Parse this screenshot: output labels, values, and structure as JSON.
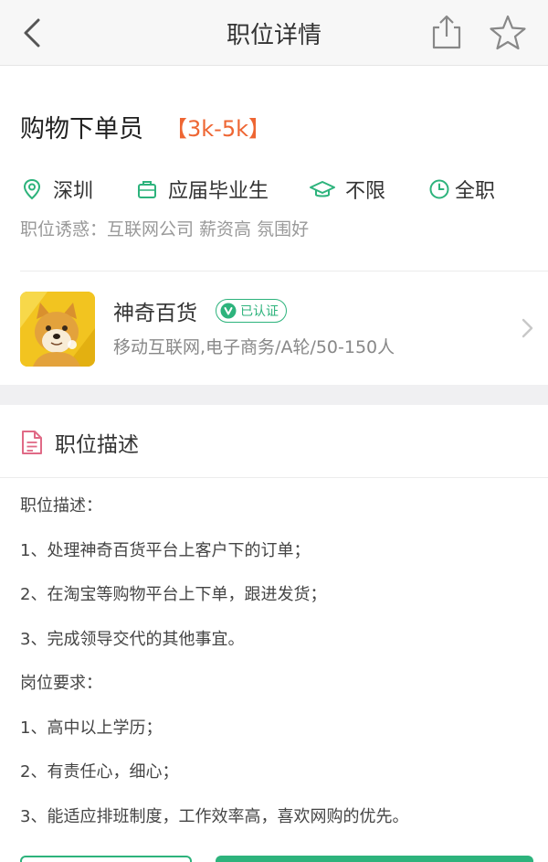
{
  "navbar": {
    "title": "职位详情",
    "back_icon": "back-chevron-icon",
    "share_icon": "share-icon",
    "favorite_icon": "star-icon"
  },
  "job": {
    "title": "购物下单员",
    "salary": "【3k-5k】",
    "tags": [
      {
        "icon": "location-icon",
        "label": "深圳"
      },
      {
        "icon": "briefcase-icon",
        "label": "应届毕业生"
      },
      {
        "icon": "graduation-cap-icon",
        "label": "不限"
      },
      {
        "icon": "clock-icon",
        "label": "全职"
      }
    ],
    "temptation": "职位诱惑：互联网公司 薪资高 氛围好"
  },
  "company": {
    "name": "神奇百货",
    "verified_label": "已认证",
    "description": "移动互联网,电子商务/A轮/50-150人"
  },
  "description_section": {
    "title": "职位描述",
    "lines": [
      "职位描述：",
      "1、处理神奇百货平台上客户下的订单；",
      "2、在淘宝等购物平台上下单，跟进发货；",
      "3、完成领导交代的其他事宜。",
      "岗位要求：",
      "1、高中以上学历；",
      "2、有责任心，细心；",
      "3、能适应排班制度，工作效率高，喜欢网购的优先。"
    ]
  },
  "colors": {
    "accent_green": "#2db37c",
    "salary_orange": "#ee6633",
    "navbar_bg": "#f7f7f7"
  }
}
